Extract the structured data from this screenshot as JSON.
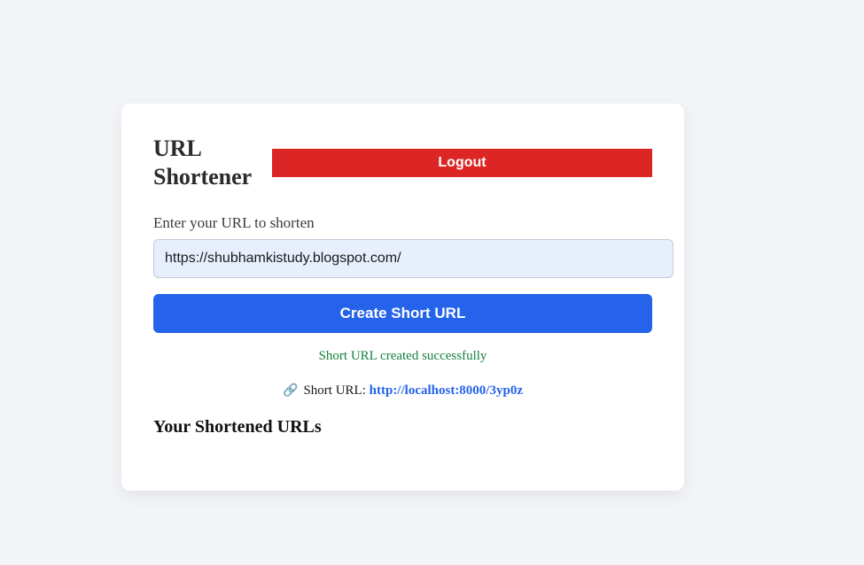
{
  "header": {
    "title": "URL Shortener",
    "logout_label": "Logout"
  },
  "form": {
    "label": "Enter your URL to shorten",
    "url_value": "https://shubhamkistudy.blogspot.com/",
    "submit_label": "Create Short URL"
  },
  "result": {
    "success_message": "Short URL created successfully",
    "short_url_label": "Short URL:",
    "short_url": "http://localhost:8000/3yp0z",
    "link_icon": "link-icon"
  },
  "list": {
    "title": "Your Shortened URLs"
  },
  "colors": {
    "logout": "#dc2626",
    "primary": "#2563eb",
    "success": "#15803d",
    "background": "#f2f4f7"
  }
}
